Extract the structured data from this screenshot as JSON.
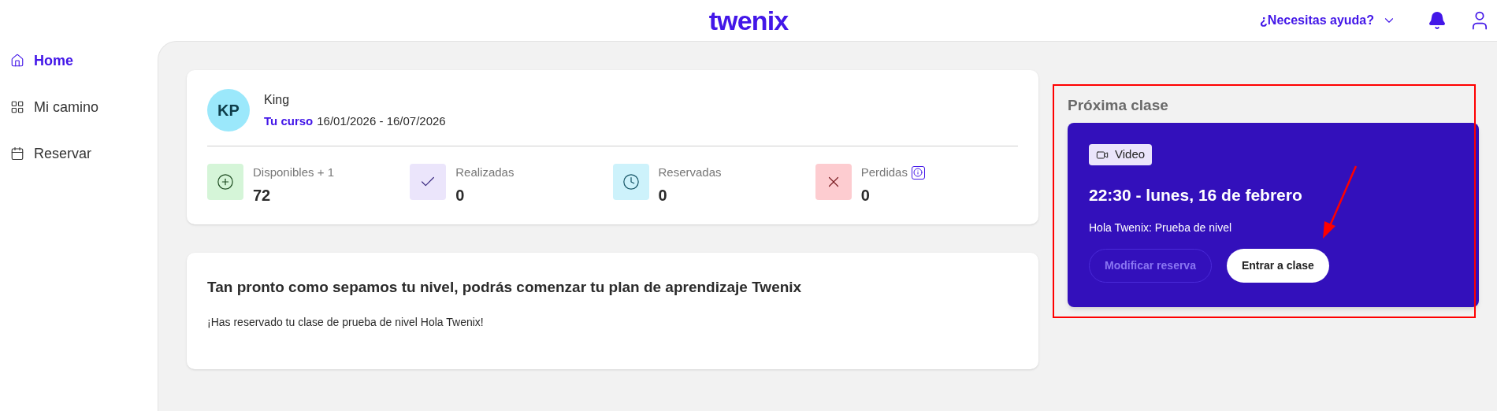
{
  "header": {
    "logo": "twenix",
    "help": "¿Necesitas ayuda?"
  },
  "sidebar": {
    "items": [
      {
        "label": "Home",
        "kind": "home",
        "selected": true
      },
      {
        "label": "Mi camino",
        "kind": "grid",
        "selected": false
      },
      {
        "label": "Reservar",
        "kind": "calendar",
        "selected": false
      }
    ]
  },
  "profile": {
    "initials": "KP",
    "name": "King",
    "course_label": "Tu curso",
    "course_dates": "16/01/2026 - 16/07/2026"
  },
  "stats": [
    {
      "kind": "available",
      "label": "Disponibles + 1",
      "value": "72",
      "info": false
    },
    {
      "kind": "done",
      "label": "Realizadas",
      "value": "0",
      "info": false
    },
    {
      "kind": "booked",
      "label": "Reservadas",
      "value": "0",
      "info": false
    },
    {
      "kind": "lost",
      "label": "Perdidas",
      "value": "0",
      "info": true
    }
  ],
  "plan_card": {
    "title": "Tan pronto como sepamos tu nivel, podrás comenzar tu plan de aprendizaje Twenix",
    "message": "¡Has reservado tu clase de prueba de nivel Hola Twenix!"
  },
  "next_class": {
    "heading": "Próxima clase",
    "badge": "Video",
    "time": "22:30 - lunes, 16 de febrero",
    "name": "Hola Twenix: Prueba de nivel",
    "buttons": [
      {
        "label": "Modificar reserva",
        "kind": "outline",
        "disabled": true
      },
      {
        "label": "Entrar a clase",
        "kind": "solid",
        "disabled": false
      }
    ]
  },
  "annotation": {
    "highlight": true,
    "arrow": true
  }
}
